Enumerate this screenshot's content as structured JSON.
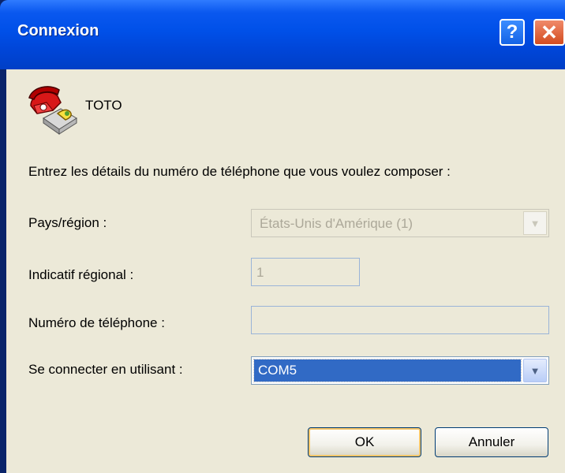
{
  "window": {
    "title": "Connexion",
    "help_glyph": "?",
    "close_glyph": "✕"
  },
  "connection": {
    "name": "TOTO",
    "icon": "phone-icon"
  },
  "prompt": "Entrez les détails du numéro de téléphone que vous voulez composer :",
  "fields": {
    "country": {
      "label": "Pays/région :",
      "value": "États-Unis d'Amérique (1)",
      "disabled": true
    },
    "area_code": {
      "label": "Indicatif régional :",
      "value": "1",
      "disabled": true
    },
    "phone": {
      "label": "Numéro de téléphone :",
      "value": "",
      "disabled": true
    },
    "connect_using": {
      "label": "Se connecter en utilisant :",
      "value": "COM5"
    }
  },
  "buttons": {
    "ok": "OK",
    "cancel": "Annuler"
  },
  "colors": {
    "titlebar": "#0054e3",
    "dialog_bg": "#ece9d8",
    "selection": "#316ac5",
    "disabled_text": "#aca899"
  }
}
